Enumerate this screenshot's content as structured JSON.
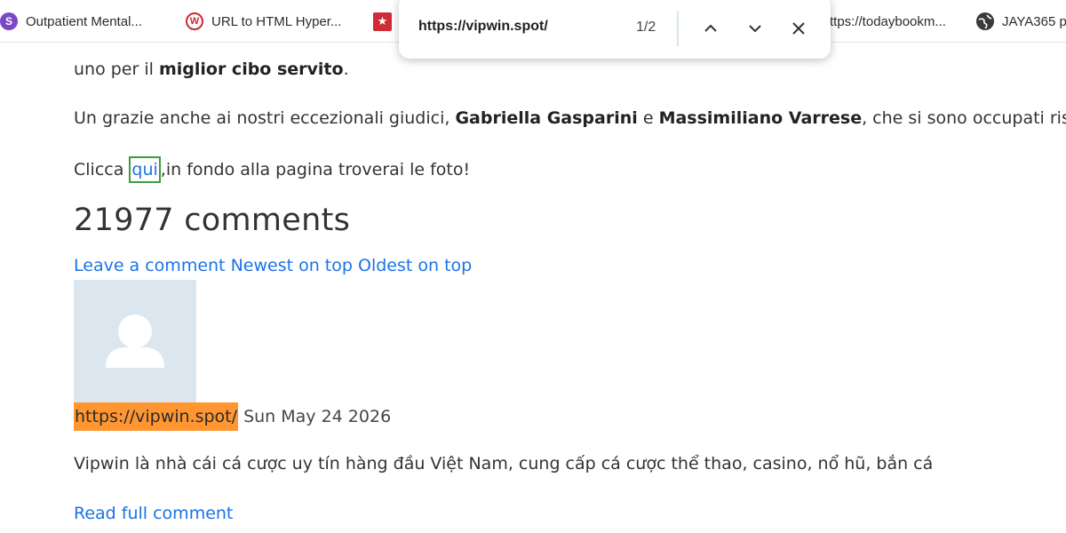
{
  "bookmarks": [
    {
      "label": "Outpatient Mental...",
      "icon": "s-letter-icon"
    },
    {
      "label": "URL to HTML Hyper...",
      "icon": "w-logo-icon"
    },
    {
      "label": "",
      "icon": "star-icon"
    },
    {
      "label": "ttps://todaybookm...",
      "icon": ""
    },
    {
      "label": "JAYA365 p",
      "icon": "globe-icon"
    }
  ],
  "find": {
    "query": "https://vipwin.spot/",
    "count": "1/2"
  },
  "article": {
    "line1_prefix": "uno per il ",
    "line1_bold": "miglior cibo servito",
    "line1_suffix": ".",
    "judges_prefix": "Un grazie anche ai nostri eccezionali giudici, ",
    "judge1": "Gabriella Gasparini",
    "judges_and": " e ",
    "judge2": "Massimiliano Varrese",
    "judges_suffix": ", che si sono occupati rispettivame",
    "click_prefix": "Clicca ",
    "click_link": "qui",
    "click_suffix": ",in fondo alla pagina troverai le foto!"
  },
  "comments": {
    "title": "21977 comments",
    "leave": "Leave a comment",
    "newest": "Newest on top",
    "oldest": "Oldest on top",
    "author": "https://vipwin.spot/",
    "date": "Sun May 24 2026",
    "text": "Vipwin là nhà cái cá cược uy tín hàng đầu Việt Nam, cung cấp cá cược thể thao, casino, nổ hũ, bắn cá",
    "read_full": "Read full comment"
  },
  "colors": {
    "link": "#1a73e8",
    "find_highlight_active": "#ff9632",
    "find_match_outline": "#3c9c3c",
    "avatar_bg": "#dbe6ef"
  }
}
